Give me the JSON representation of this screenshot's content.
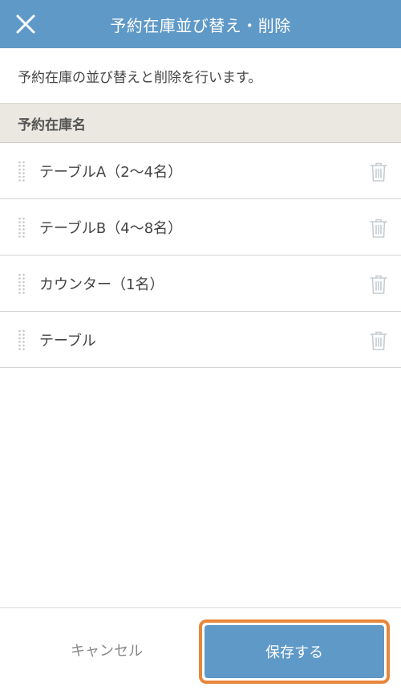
{
  "header": {
    "title": "予約在庫並び替え・削除",
    "close_icon": "close-icon"
  },
  "description": "予約在庫の並び替えと削除を行います。",
  "section": {
    "title": "予約在庫名"
  },
  "items": [
    {
      "label": "テーブルA（2〜4名）"
    },
    {
      "label": "テーブルB（4〜8名）"
    },
    {
      "label": "カウンター（1名）"
    },
    {
      "label": "テーブル"
    }
  ],
  "icons": {
    "drag": "drag-handle-icon",
    "delete": "trash-icon"
  },
  "footer": {
    "cancel_label": "キャンセル",
    "save_label": "保存する"
  },
  "colors": {
    "primary": "#5f99c7",
    "section_bg": "#ebe8e1",
    "highlight": "#e8863a"
  }
}
